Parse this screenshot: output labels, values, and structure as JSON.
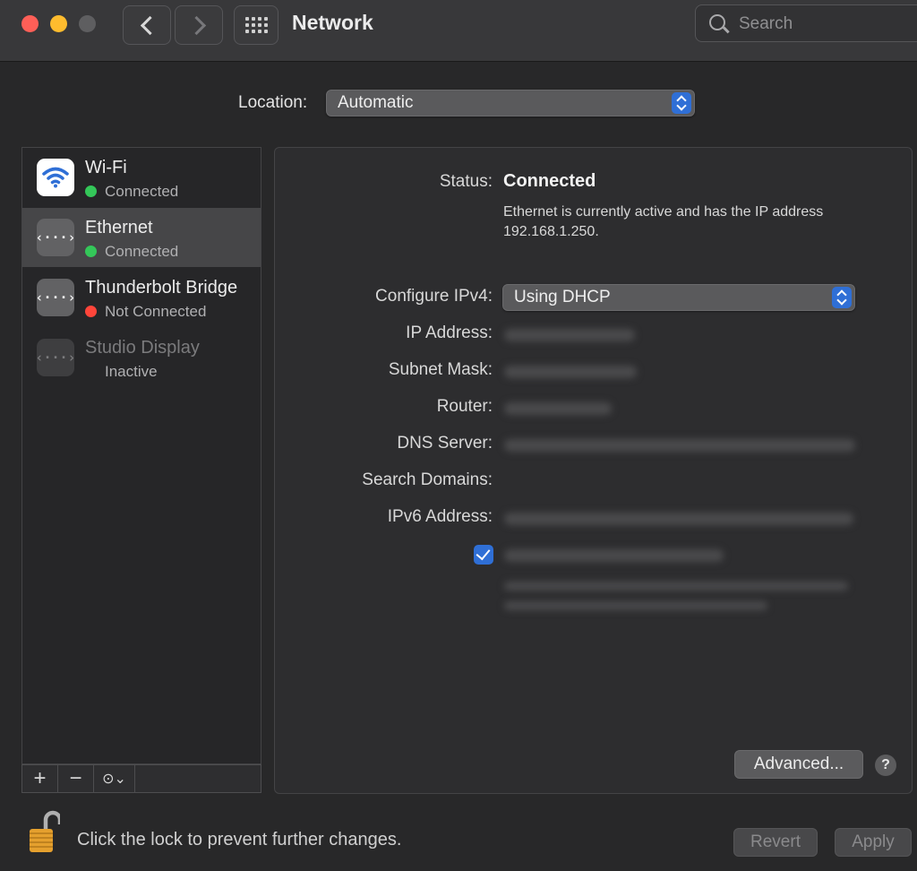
{
  "window": {
    "title": "Network"
  },
  "search": {
    "placeholder": "Search"
  },
  "location": {
    "label": "Location:",
    "value": "Automatic"
  },
  "services": [
    {
      "name": "Wi-Fi",
      "status": "Connected",
      "status_color": "#34c759",
      "icon": "wifi-icon"
    },
    {
      "name": "Ethernet",
      "status": "Connected",
      "status_color": "#34c759",
      "icon": "ethernet-icon",
      "selected": true
    },
    {
      "name": "Thunderbolt Bridge",
      "status": "Not Connected",
      "status_color": "#ff453a",
      "icon": "ethernet-icon"
    },
    {
      "name": "Studio Display",
      "status": "Inactive",
      "icon": "ethernet-icon",
      "inactive": true
    }
  ],
  "sidebar_footer": {
    "add": "+",
    "remove": "−",
    "action": "⊙⌄"
  },
  "detail": {
    "status_label": "Status:",
    "status_value": "Connected",
    "status_description": "Ethernet is currently active and has the IP address 192.168.1.250.",
    "configure_label": "Configure IPv4:",
    "configure_value": "Using DHCP",
    "ip_label": "IP Address:",
    "subnet_label": "Subnet Mask:",
    "router_label": "Router:",
    "dns_label": "DNS Server:",
    "search_domains_label": "Search Domains:",
    "ipv6_label": "IPv6 Address:",
    "checkbox_checked": true,
    "advanced_label": "Advanced...",
    "help_label": "?"
  },
  "bottom": {
    "lock_message": "Click the lock to prevent further changes.",
    "revert_label": "Revert",
    "apply_label": "Apply"
  },
  "colors": {
    "accent": "#2f6fd6",
    "connected": "#34c759",
    "not_connected": "#ff453a"
  }
}
